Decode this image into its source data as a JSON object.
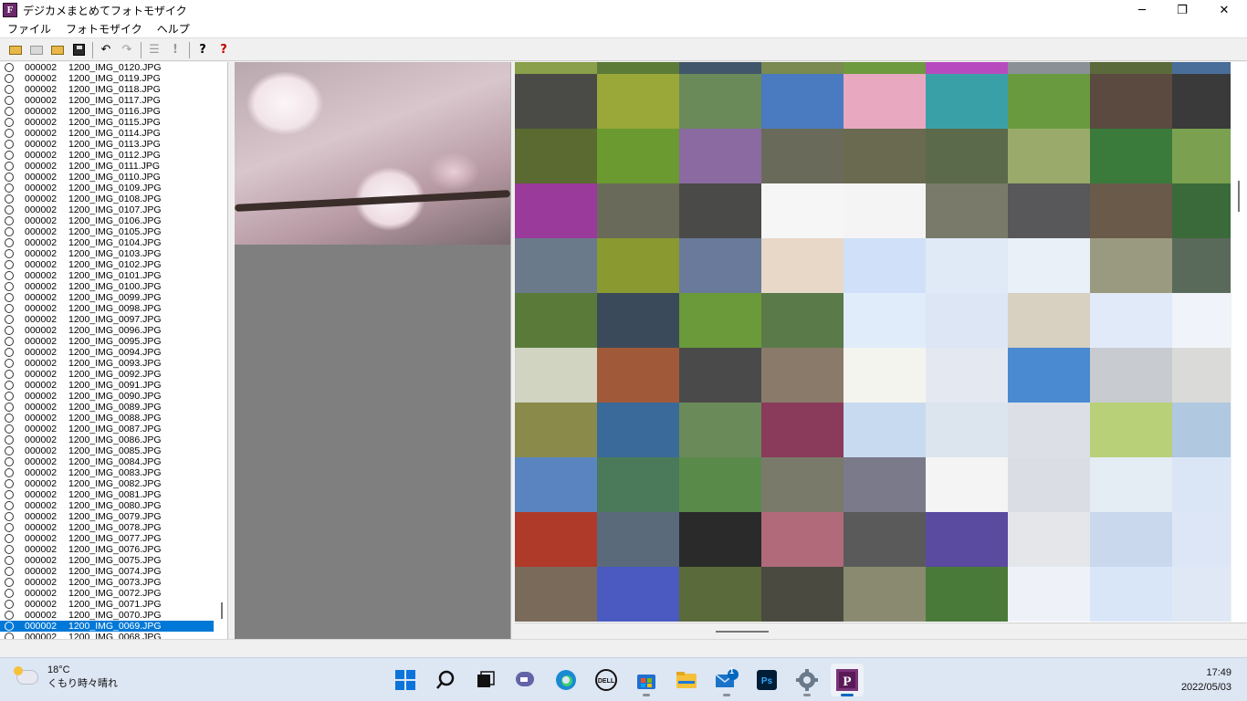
{
  "window": {
    "title": "デジカメまとめてフォトモザイク",
    "icon_letter": "F",
    "minimize": "─",
    "restore": "❐",
    "close": "✕"
  },
  "menu": {
    "file": "ファイル",
    "photomosaic": "フォトモザイク",
    "help": "ヘルプ"
  },
  "toolbar": {
    "undo": "↶",
    "redo": "↷",
    "list": "☰",
    "run": "!",
    "about": "?",
    "help": "?"
  },
  "file_list": [
    {
      "num": "000002",
      "name": "1200_IMG_0120.JPG"
    },
    {
      "num": "000002",
      "name": "1200_IMG_0119.JPG"
    },
    {
      "num": "000002",
      "name": "1200_IMG_0118.JPG"
    },
    {
      "num": "000002",
      "name": "1200_IMG_0117.JPG"
    },
    {
      "num": "000002",
      "name": "1200_IMG_0116.JPG"
    },
    {
      "num": "000002",
      "name": "1200_IMG_0115.JPG"
    },
    {
      "num": "000002",
      "name": "1200_IMG_0114.JPG"
    },
    {
      "num": "000002",
      "name": "1200_IMG_0113.JPG"
    },
    {
      "num": "000002",
      "name": "1200_IMG_0112.JPG"
    },
    {
      "num": "000002",
      "name": "1200_IMG_0111.JPG"
    },
    {
      "num": "000002",
      "name": "1200_IMG_0110.JPG"
    },
    {
      "num": "000002",
      "name": "1200_IMG_0109.JPG"
    },
    {
      "num": "000002",
      "name": "1200_IMG_0108.JPG"
    },
    {
      "num": "000002",
      "name": "1200_IMG_0107.JPG"
    },
    {
      "num": "000002",
      "name": "1200_IMG_0106.JPG"
    },
    {
      "num": "000002",
      "name": "1200_IMG_0105.JPG"
    },
    {
      "num": "000002",
      "name": "1200_IMG_0104.JPG"
    },
    {
      "num": "000002",
      "name": "1200_IMG_0103.JPG"
    },
    {
      "num": "000002",
      "name": "1200_IMG_0102.JPG"
    },
    {
      "num": "000002",
      "name": "1200_IMG_0101.JPG"
    },
    {
      "num": "000002",
      "name": "1200_IMG_0100.JPG"
    },
    {
      "num": "000002",
      "name": "1200_IMG_0099.JPG"
    },
    {
      "num": "000002",
      "name": "1200_IMG_0098.JPG"
    },
    {
      "num": "000002",
      "name": "1200_IMG_0097.JPG"
    },
    {
      "num": "000002",
      "name": "1200_IMG_0096.JPG"
    },
    {
      "num": "000002",
      "name": "1200_IMG_0095.JPG"
    },
    {
      "num": "000002",
      "name": "1200_IMG_0094.JPG"
    },
    {
      "num": "000002",
      "name": "1200_IMG_0093.JPG"
    },
    {
      "num": "000002",
      "name": "1200_IMG_0092.JPG"
    },
    {
      "num": "000002",
      "name": "1200_IMG_0091.JPG"
    },
    {
      "num": "000002",
      "name": "1200_IMG_0090.JPG"
    },
    {
      "num": "000002",
      "name": "1200_IMG_0089.JPG"
    },
    {
      "num": "000002",
      "name": "1200_IMG_0088.JPG"
    },
    {
      "num": "000002",
      "name": "1200_IMG_0087.JPG"
    },
    {
      "num": "000002",
      "name": "1200_IMG_0086.JPG"
    },
    {
      "num": "000002",
      "name": "1200_IMG_0085.JPG"
    },
    {
      "num": "000002",
      "name": "1200_IMG_0084.JPG"
    },
    {
      "num": "000002",
      "name": "1200_IMG_0083.JPG"
    },
    {
      "num": "000002",
      "name": "1200_IMG_0082.JPG"
    },
    {
      "num": "000002",
      "name": "1200_IMG_0081.JPG"
    },
    {
      "num": "000002",
      "name": "1200_IMG_0080.JPG"
    },
    {
      "num": "000002",
      "name": "1200_IMG_0079.JPG"
    },
    {
      "num": "000002",
      "name": "1200_IMG_0078.JPG"
    },
    {
      "num": "000002",
      "name": "1200_IMG_0077.JPG"
    },
    {
      "num": "000002",
      "name": "1200_IMG_0076.JPG"
    },
    {
      "num": "000002",
      "name": "1200_IMG_0075.JPG"
    },
    {
      "num": "000002",
      "name": "1200_IMG_0074.JPG"
    },
    {
      "num": "000002",
      "name": "1200_IMG_0073.JPG"
    },
    {
      "num": "000002",
      "name": "1200_IMG_0072.JPG"
    },
    {
      "num": "000002",
      "name": "1200_IMG_0071.JPG"
    },
    {
      "num": "000002",
      "name": "1200_IMG_0070.JPG"
    },
    {
      "num": "000002",
      "name": "1200_IMG_0069.JPG",
      "selected": true
    },
    {
      "num": "000002",
      "name": "1200_IMG_0068.JPG"
    }
  ],
  "mosaic_tiles": [
    "#8aa04a",
    "#5c7a38",
    "#41566a",
    "#7a8a50",
    "#6d9a3e",
    "#b84ac0",
    "#8a9096",
    "#5a6a3a",
    "#4a6e9a",
    "#4a4a46",
    "#9aa83a",
    "#6a8a5a",
    "#4a7ac0",
    "#e8a8c0",
    "#3aa0a8",
    "#6a9a40",
    "#5a4a40",
    "#3a3a3a",
    "#5a6a30",
    "#6a9a30",
    "#8a6aa0",
    "#6a6a5a",
    "#6a6a50",
    "#5a6a4a",
    "#9aaa6a",
    "#3a7a3a",
    "#7aa050",
    "#9a3a9a",
    "#6a6a5a",
    "#4a4a48",
    "#f6f6f6",
    "#f4f4f4",
    "#7a7a6a",
    "#58585a",
    "#6a5a4a",
    "#3a6a3a",
    "#6a7a8a",
    "#8a9a30",
    "#6a7a9a",
    "#e8d8c8",
    "#d0e0f8",
    "#e0eaf6",
    "#eaf0f8",
    "#9a9a80",
    "#5a6a5a",
    "#5a7a3a",
    "#3a4a5a",
    "#6a9a3a",
    "#5a7a4a",
    "#e0ecfa",
    "#dce6f4",
    "#d8d0c0",
    "#e0eaf8",
    "#f0f4fa",
    "#d0d4c0",
    "#a05a3a",
    "#4a4a4a",
    "#8a7a6a",
    "#f4f4ee",
    "#e4e8f0",
    "#4a8ad0",
    "#c8ccd0",
    "#dadad8",
    "#8a8a4a",
    "#3a6a9a",
    "#6a8a5a",
    "#8a3a5a",
    "#c8daf0",
    "#dce4ee",
    "#dce0e6",
    "#b8d078",
    "#b0c8e0",
    "#5a84c0",
    "#4a7a5a",
    "#5a8a4a",
    "#7a7a6a",
    "#7a7a8a",
    "#f4f4f4",
    "#dadee4",
    "#e4ecf4",
    "#dae6f6",
    "#b03a2a",
    "#5a6a7a",
    "#2a2a2a",
    "#b06a7a",
    "#5a5a5a",
    "#5a4aa0",
    "#e4e6ea",
    "#cad8ee",
    "#dce6f6",
    "#7a6a5a",
    "#4a5ac0",
    "#5a6a3a",
    "#4a4a40",
    "#8a8a70",
    "#4a7a3a",
    "#eef2f8",
    "#d8e6f8",
    "#e0e8f6"
  ],
  "taskbar": {
    "weather_temp": "18°C",
    "weather_desc": "くもり時々晴れ",
    "mail_badge": "1",
    "time": "17:49",
    "date": "2022/05/03"
  }
}
